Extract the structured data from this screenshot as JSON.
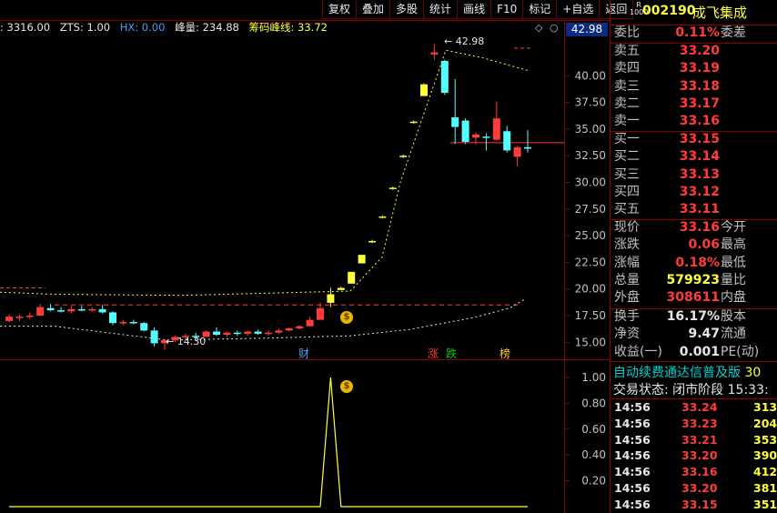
{
  "toolbar": [
    "复权",
    "叠加",
    "多股",
    "统计",
    "画线",
    "F10",
    "标记",
    "+自选",
    "返回"
  ],
  "infoline": {
    "vol": ": 3316.00",
    "zts": "ZTS: 1.00",
    "hx": "HX: 0.00",
    "peak": "峰量: 234.88",
    "chip": "筹码峰线: 33.72"
  },
  "main_chart": {
    "price_badge": "42.98",
    "high_label": "42.98",
    "low_label": "14.30",
    "y_ticks": [
      "40.00",
      "37.50",
      "35.00",
      "32.50",
      "30.00",
      "27.50",
      "25.00",
      "22.50",
      "20.00",
      "17.50",
      "15.00"
    ],
    "markers": [
      {
        "label": "财",
        "color": "#4aa0ff"
      },
      {
        "label": "涨",
        "color": "#ff3b3b"
      },
      {
        "label": "跌",
        "color": "#00d000"
      },
      {
        "label": "榜",
        "color": "#ffcc33"
      }
    ],
    "colors": {
      "up": "#ff3b3b",
      "down": "#54ffff",
      "limit": "#ffff3c",
      "chip": "#ffff3c"
    }
  },
  "chart_data": {
    "type": "candlestick",
    "ylim": [
      13.4,
      43.7
    ],
    "candles": [
      {
        "o": 17.0,
        "h": 17.6,
        "l": 16.9,
        "c": 17.4
      },
      {
        "o": 17.3,
        "h": 17.6,
        "l": 17.0,
        "c": 17.4
      },
      {
        "o": 17.4,
        "h": 17.8,
        "l": 17.2,
        "c": 17.5
      },
      {
        "o": 17.5,
        "h": 18.6,
        "l": 17.5,
        "c": 18.3
      },
      {
        "o": 18.2,
        "h": 18.6,
        "l": 17.9,
        "c": 18.0
      },
      {
        "o": 18.0,
        "h": 18.3,
        "l": 17.8,
        "c": 17.9
      },
      {
        "o": 17.9,
        "h": 18.4,
        "l": 17.7,
        "c": 18.1
      },
      {
        "o": 18.1,
        "h": 18.4,
        "l": 17.9,
        "c": 18.0
      },
      {
        "o": 18.0,
        "h": 18.3,
        "l": 17.9,
        "c": 18.1
      },
      {
        "o": 18.1,
        "h": 18.5,
        "l": 17.7,
        "c": 17.8
      },
      {
        "o": 17.8,
        "h": 17.9,
        "l": 16.6,
        "c": 16.8
      },
      {
        "o": 16.8,
        "h": 17.1,
        "l": 16.6,
        "c": 16.9
      },
      {
        "o": 16.9,
        "h": 17.1,
        "l": 16.7,
        "c": 16.8
      },
      {
        "o": 16.8,
        "h": 16.9,
        "l": 16.0,
        "c": 16.1
      },
      {
        "o": 16.1,
        "h": 16.4,
        "l": 14.6,
        "c": 14.9
      },
      {
        "o": 14.9,
        "h": 15.3,
        "l": 14.3,
        "c": 15.2
      },
      {
        "o": 15.2,
        "h": 15.6,
        "l": 15.0,
        "c": 15.5
      },
      {
        "o": 15.5,
        "h": 15.8,
        "l": 15.3,
        "c": 15.6
      },
      {
        "o": 15.6,
        "h": 15.9,
        "l": 15.3,
        "c": 15.5
      },
      {
        "o": 15.5,
        "h": 16.1,
        "l": 15.5,
        "c": 16.0
      },
      {
        "o": 16.0,
        "h": 16.4,
        "l": 15.6,
        "c": 15.7
      },
      {
        "o": 15.7,
        "h": 16.0,
        "l": 15.5,
        "c": 15.9
      },
      {
        "o": 15.9,
        "h": 16.1,
        "l": 15.6,
        "c": 15.8
      },
      {
        "o": 15.8,
        "h": 16.1,
        "l": 15.6,
        "c": 16.0
      },
      {
        "o": 16.0,
        "h": 16.2,
        "l": 15.7,
        "c": 15.8
      },
      {
        "o": 15.8,
        "h": 16.1,
        "l": 15.6,
        "c": 15.9
      },
      {
        "o": 15.9,
        "h": 16.3,
        "l": 15.8,
        "c": 16.1
      },
      {
        "o": 16.1,
        "h": 16.4,
        "l": 16.0,
        "c": 16.3
      },
      {
        "o": 16.3,
        "h": 16.6,
        "l": 16.2,
        "c": 16.5
      },
      {
        "o": 16.5,
        "h": 17.4,
        "l": 16.5,
        "c": 17.1
      },
      {
        "o": 17.1,
        "h": 18.7,
        "l": 17.1,
        "c": 18.2
      },
      {
        "o": 18.7,
        "h": 20.1,
        "l": 18.3,
        "c": 19.5
      },
      {
        "o": 19.9,
        "h": 20.2,
        "l": 19.9,
        "c": 20.1
      },
      {
        "o": 20.5,
        "h": 21.6,
        "l": 20.5,
        "c": 21.6
      },
      {
        "o": 22.4,
        "h": 23.2,
        "l": 22.4,
        "c": 23.2
      },
      {
        "o": 24.4,
        "h": 24.6,
        "l": 24.3,
        "c": 24.5
      },
      {
        "o": 26.7,
        "h": 26.9,
        "l": 26.6,
        "c": 26.8
      },
      {
        "o": 29.4,
        "h": 29.6,
        "l": 29.3,
        "c": 29.5
      },
      {
        "o": 32.4,
        "h": 32.6,
        "l": 32.3,
        "c": 32.5
      },
      {
        "o": 35.6,
        "h": 35.8,
        "l": 35.5,
        "c": 35.7
      },
      {
        "o": 38.1,
        "h": 39.3,
        "l": 38.1,
        "c": 39.2
      },
      {
        "o": 42.0,
        "h": 42.98,
        "l": 41.5,
        "c": 42.2
      },
      {
        "o": 41.4,
        "h": 41.5,
        "l": 38.2,
        "c": 38.4
      },
      {
        "o": 36.1,
        "h": 39.7,
        "l": 33.6,
        "c": 35.2
      },
      {
        "o": 35.8,
        "h": 36.0,
        "l": 33.6,
        "c": 33.8
      },
      {
        "o": 34.2,
        "h": 34.7,
        "l": 33.6,
        "c": 34.5
      },
      {
        "o": 34.3,
        "h": 34.6,
        "l": 33.0,
        "c": 34.2
      },
      {
        "o": 34.0,
        "h": 37.6,
        "l": 33.9,
        "c": 36.0
      },
      {
        "o": 34.8,
        "h": 35.3,
        "l": 32.8,
        "c": 33.0
      },
      {
        "o": 32.4,
        "h": 33.4,
        "l": 31.5,
        "c": 33.3
      },
      {
        "o": 33.3,
        "h": 34.9,
        "l": 32.8,
        "c": 33.16
      }
    ]
  },
  "sub_chart": {
    "y_ticks": [
      "1.00",
      "0.80",
      "0.60",
      "0.40",
      "0.20"
    ],
    "values": [
      0,
      0,
      0,
      0,
      0,
      0,
      0,
      0,
      0,
      0,
      0,
      0,
      0,
      0,
      0,
      0,
      0,
      0,
      0,
      0,
      0,
      0,
      0,
      0,
      0,
      0,
      0,
      0,
      0,
      0,
      0,
      1,
      0,
      0,
      0,
      0,
      0,
      0,
      0,
      0,
      0,
      0,
      0,
      0,
      0,
      0,
      0,
      0,
      0,
      0,
      0
    ]
  },
  "quote": {
    "badge_top": "R",
    "badge_bottom": "1000",
    "code": "002190",
    "name": "成飞集成",
    "weibi_label": "委比",
    "weibi_value": "0.11%",
    "weicha_label": "委差",
    "asks": [
      {
        "label": "卖五",
        "price": "33.20"
      },
      {
        "label": "卖四",
        "price": "33.19"
      },
      {
        "label": "卖三",
        "price": "33.18"
      },
      {
        "label": "卖二",
        "price": "33.17"
      },
      {
        "label": "卖一",
        "price": "33.16"
      }
    ],
    "bids": [
      {
        "label": "买一",
        "price": "33.15"
      },
      {
        "label": "买二",
        "price": "33.14"
      },
      {
        "label": "买三",
        "price": "33.13"
      },
      {
        "label": "买四",
        "price": "33.12"
      },
      {
        "label": "买五",
        "price": "33.11"
      }
    ],
    "stats": [
      {
        "k": "现价",
        "v": "33.16",
        "c": "red",
        "k2": "今开"
      },
      {
        "k": "涨跌",
        "v": "0.06",
        "c": "red",
        "k2": "最高"
      },
      {
        "k": "涨幅",
        "v": "0.18%",
        "c": "red",
        "k2": "最低"
      },
      {
        "k": "总量",
        "v": "579923",
        "c": "yellow",
        "k2": "量比"
      },
      {
        "k": "外盘",
        "v": "308611",
        "c": "red",
        "k2": "内盘"
      }
    ],
    "stats2": [
      {
        "k": "换手",
        "v": "16.17%",
        "c": "white",
        "k2": "股本"
      },
      {
        "k": "净资",
        "v": "9.47",
        "c": "white",
        "k2": "流通"
      },
      {
        "k": "收益(一)",
        "v": "0.001",
        "c": "white",
        "k2": "PE(动)"
      }
    ],
    "banner": "自动续费通达信普及版",
    "banner_tail": "30",
    "status_label": "交易状态: 闭市阶段",
    "status_time": "15:33:",
    "ticks": [
      {
        "t": "14:56",
        "p": "33.24",
        "v": "313"
      },
      {
        "t": "14:56",
        "p": "33.23",
        "v": "204"
      },
      {
        "t": "14:56",
        "p": "33.21",
        "v": "353"
      },
      {
        "t": "14:56",
        "p": "33.20",
        "v": "390"
      },
      {
        "t": "14:56",
        "p": "33.16",
        "v": "412"
      },
      {
        "t": "14:56",
        "p": "33.20",
        "v": "381"
      },
      {
        "t": "14:56",
        "p": "33.15",
        "v": "351"
      }
    ]
  }
}
